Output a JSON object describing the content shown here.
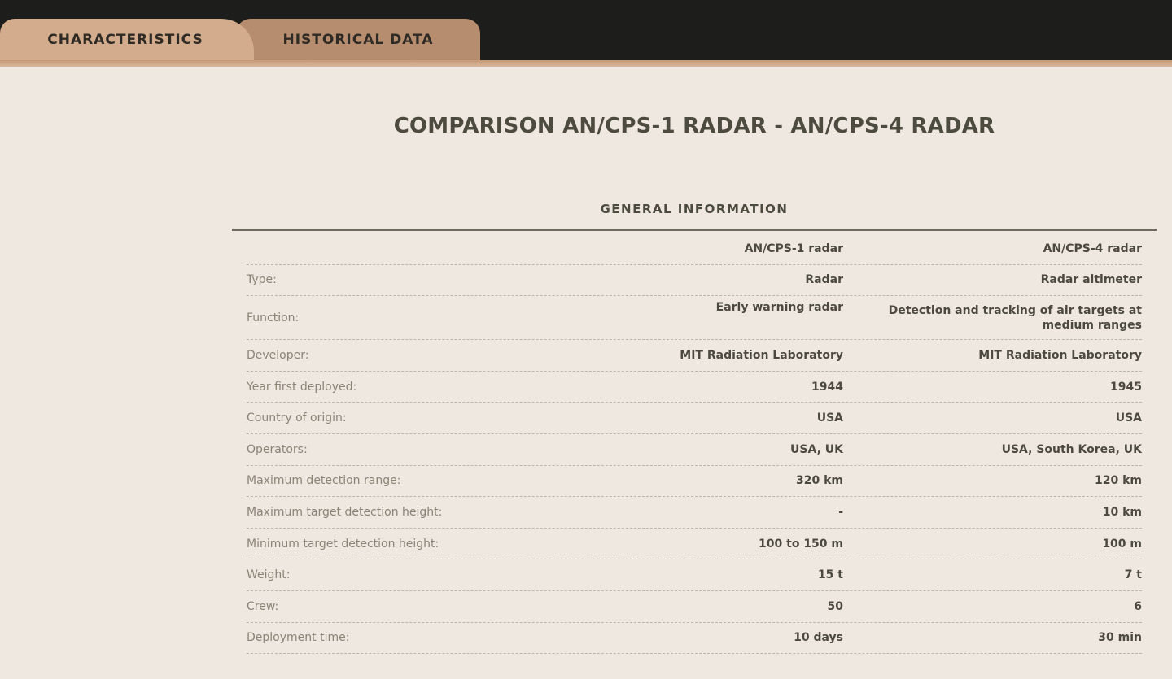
{
  "tabs": [
    {
      "label": "CHARACTERISTICS",
      "active": true
    },
    {
      "label": "HISTORICAL DATA",
      "active": false
    }
  ],
  "page_title": "COMPARISON AN/CPS-1 RADAR - AN/CPS-4 RADAR",
  "section_title": "GENERAL INFORMATION",
  "table": {
    "header": {
      "label": "",
      "a": "AN/CPS-1 radar",
      "b": "AN/CPS-4 radar"
    },
    "rows": [
      {
        "label": "Type:",
        "a": "Radar",
        "b": "Radar altimeter"
      },
      {
        "label": "Function:",
        "a": "Early warning radar",
        "b": "Detection and tracking of air targets at medium ranges"
      },
      {
        "label": "Developer:",
        "a": "MIT Radiation Laboratory",
        "b": "MIT Radiation Laboratory"
      },
      {
        "label": "Year first deployed:",
        "a": "1944",
        "b": "1945"
      },
      {
        "label": "Country of origin:",
        "a": "USA",
        "b": "USA"
      },
      {
        "label": "Operators:",
        "a": "USA, UK",
        "b": "USA, South Korea, UK"
      },
      {
        "label": "Maximum detection range:",
        "a": "320 km",
        "b": "120 km"
      },
      {
        "label": "Maximum target detection height:",
        "a": "-",
        "b": "10 km"
      },
      {
        "label": "Minimum target detection height:",
        "a": "100 to 150 m",
        "b": "100 m"
      },
      {
        "label": "Weight:",
        "a": "15 t",
        "b": "7 t"
      },
      {
        "label": "Crew:",
        "a": "50",
        "b": "6"
      },
      {
        "label": "Deployment time:",
        "a": "10 days",
        "b": "30 min"
      }
    ]
  }
}
